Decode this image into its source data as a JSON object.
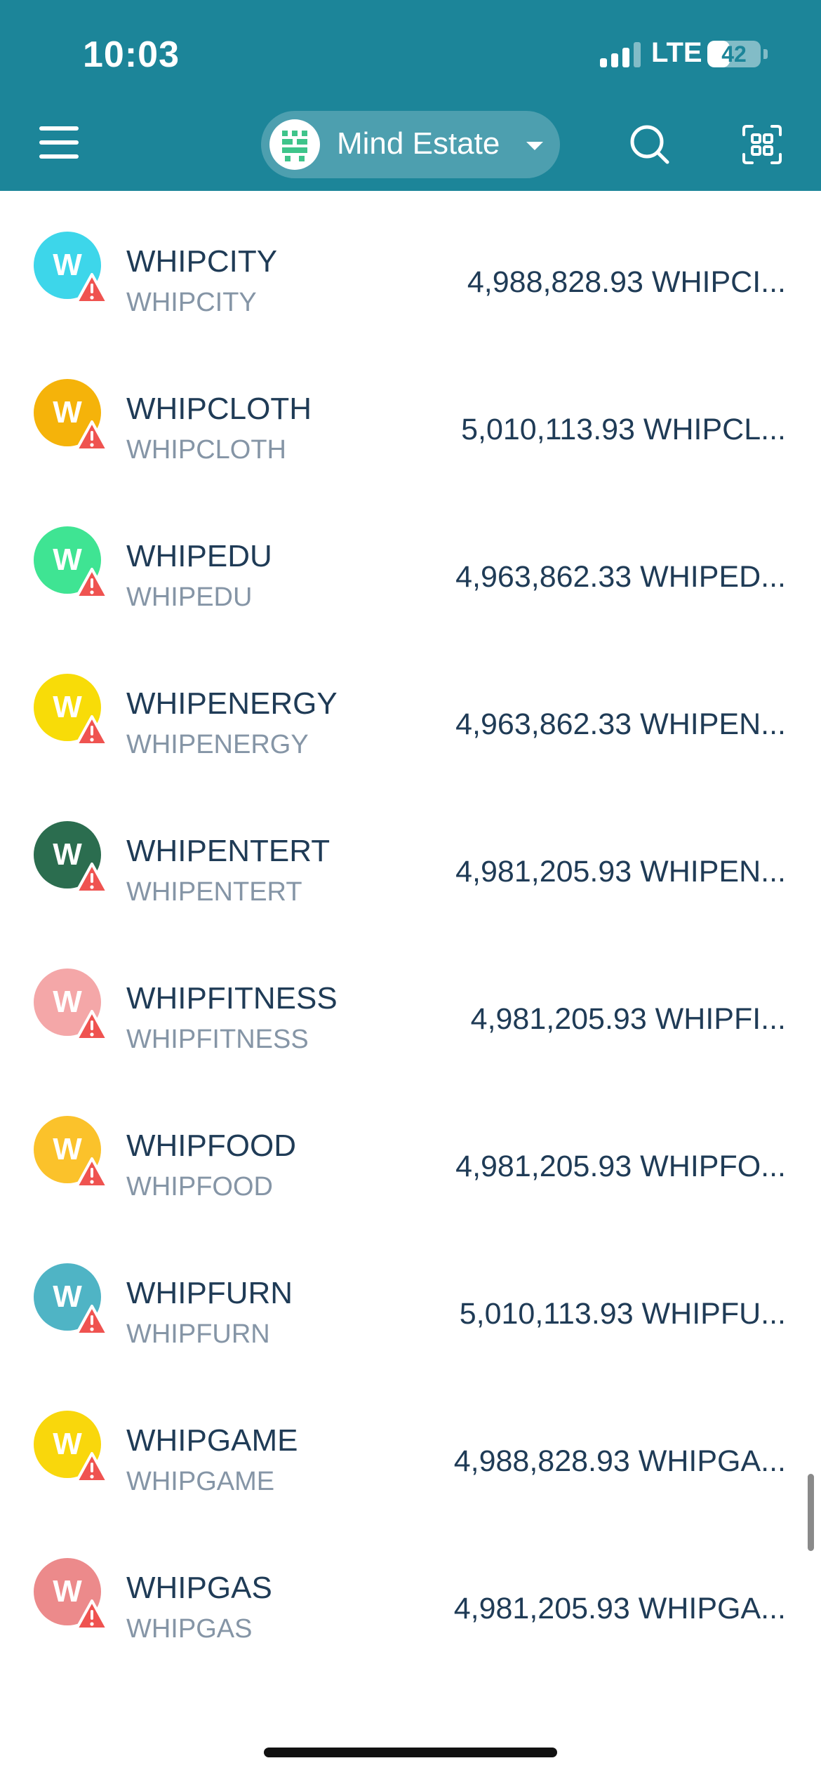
{
  "status_bar": {
    "time": "10:03",
    "network": "LTE",
    "battery": "42",
    "battery_level": 0.42
  },
  "header": {
    "network_name": "Mind Estate",
    "accent_color": "#1c8599"
  },
  "tokens": [
    {
      "name": "WHIPCITY",
      "symbol": "WHIPCITY",
      "balance": "4,988,828.93 WHIPCI...",
      "color": "#3dd6ea",
      "letter": "W"
    },
    {
      "name": "WHIPCLOTH",
      "symbol": "WHIPCLOTH",
      "balance": "5,010,113.93 WHIPCL...",
      "color": "#f5b30a",
      "letter": "W"
    },
    {
      "name": "WHIPEDU",
      "symbol": "WHIPEDU",
      "balance": "4,963,862.33 WHIPED...",
      "color": "#3fe493",
      "letter": "W"
    },
    {
      "name": "WHIPENERGY",
      "symbol": "WHIPENERGY",
      "balance": "4,963,862.33 WHIPEN...",
      "color": "#f8dc08",
      "letter": "W"
    },
    {
      "name": "WHIPENTERT",
      "symbol": "WHIPENTERT",
      "balance": "4,981,205.93 WHIPEN...",
      "color": "#2b6d4f",
      "letter": "W"
    },
    {
      "name": "WHIPFITNESS",
      "symbol": "WHIPFITNESS",
      "balance": "4,981,205.93 WHIPFI...",
      "color": "#f4a7a8",
      "letter": "W"
    },
    {
      "name": "WHIPFOOD",
      "symbol": "WHIPFOOD",
      "balance": "4,981,205.93 WHIPFO...",
      "color": "#fbc22b",
      "letter": "W"
    },
    {
      "name": "WHIPFURN",
      "symbol": "WHIPFURN",
      "balance": "5,010,113.93 WHIPFU...",
      "color": "#4fb4c5",
      "letter": "W"
    },
    {
      "name": "WHIPGAME",
      "symbol": "WHIPGAME",
      "balance": "4,988,828.93 WHIPGA...",
      "color": "#f9d70c",
      "letter": "W"
    },
    {
      "name": "WHIPGAS",
      "symbol": "WHIPGAS",
      "balance": "4,981,205.93 WHIPGA...",
      "color": "#ec8a8b",
      "letter": "W"
    }
  ],
  "warning_color": "#ef5350"
}
